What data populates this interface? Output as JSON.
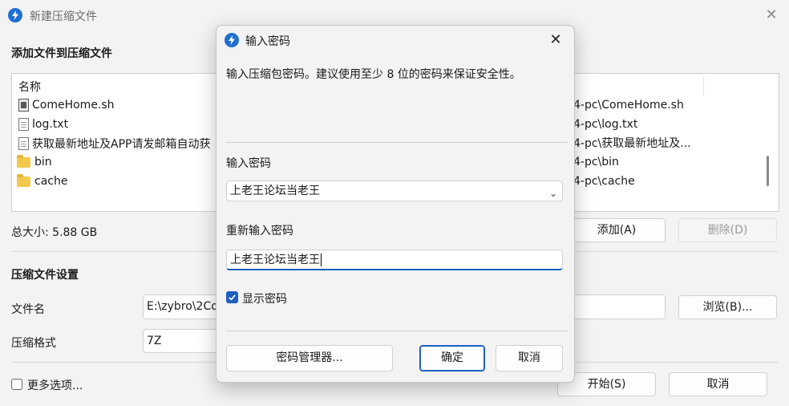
{
  "main": {
    "title": "新建压缩文件",
    "add_section_title": "添加文件到压缩文件",
    "list_header": "名称",
    "files": [
      {
        "name": "ComeHome.sh",
        "type": "shell",
        "path": "4-pc\\ComeHome.sh"
      },
      {
        "name": "log.txt",
        "type": "file",
        "path": "4-pc\\log.txt"
      },
      {
        "name": "获取最新地址及APP请发邮箱自动获",
        "type": "file",
        "path": "4-pc\\获取最新地址及..."
      },
      {
        "name": "bin",
        "type": "folder",
        "path": "4-pc\\bin"
      },
      {
        "name": "cache",
        "type": "folder",
        "path": "4-pc\\cache"
      }
    ],
    "total_size": "总大小: 5.88 GB",
    "add_button": "添加(A)",
    "delete_button": "删除(D)",
    "settings_title": "压缩文件设置",
    "filename_label": "文件名",
    "filename_value": "E:\\zybro\\2Co",
    "browse_button": "浏览(B)...",
    "format_label": "压缩格式",
    "format_value": "7Z",
    "more_options": "更多选项...",
    "start_button": "开始(S)",
    "cancel_button": "取消"
  },
  "dialog": {
    "title": "输入密码",
    "description": "输入压缩包密码。建议使用至少 8 位的密码来保证安全性。",
    "password_label": "输入密码",
    "password_value": "上老王论坛当老王",
    "confirm_label": "重新输入密码",
    "confirm_value": "上老王论坛当老王",
    "show_password": "显示密码",
    "show_password_checked": true,
    "manager_button": "密码管理器...",
    "ok_button": "确定",
    "cancel_button": "取消"
  },
  "colors": {
    "accent": "#1f5fbf",
    "app_icon": "#1f6fd1",
    "folder": "#f2c94c"
  }
}
